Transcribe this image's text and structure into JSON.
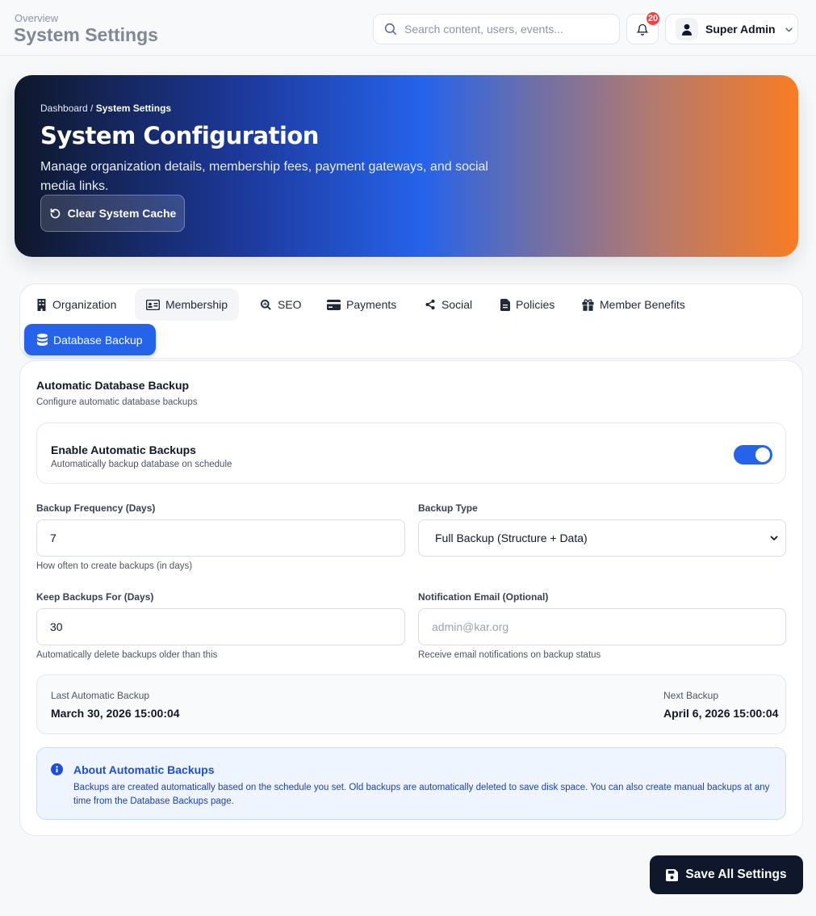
{
  "header": {
    "overview": "Overview",
    "title": "System Settings",
    "search_placeholder": "Search content, users, events...",
    "notifications_count": "20",
    "user_name": "Super Admin"
  },
  "hero": {
    "breadcrumb_root": "Dashboard",
    "breadcrumb_sep": " / ",
    "breadcrumb_current": "System Settings",
    "title": "System Configuration",
    "subtitle": "Manage organization details, membership fees, payment gateways, and social media links.",
    "clear_cache_label": "Clear System Cache"
  },
  "tabs": [
    {
      "label": "Organization",
      "icon": "building-icon"
    },
    {
      "label": "Membership",
      "icon": "id-card-icon"
    },
    {
      "label": "SEO",
      "icon": "search-chart-icon"
    },
    {
      "label": "Payments",
      "icon": "credit-card-icon"
    },
    {
      "label": "Social",
      "icon": "share-icon"
    },
    {
      "label": "Policies",
      "icon": "document-icon"
    },
    {
      "label": "Member Benefits",
      "icon": "gift-icon"
    },
    {
      "label": "Database Backup",
      "icon": "database-icon",
      "active": true
    }
  ],
  "backup": {
    "title": "Automatic Database Backup",
    "subtitle": "Configure automatic database backups",
    "enable_title": "Enable Automatic Backups",
    "enable_sub": "Automatically backup database on schedule",
    "enabled": true,
    "frequency_label": "Backup Frequency (Days)",
    "frequency_value": "7",
    "frequency_help": "How often to create backups (in days)",
    "type_label": "Backup Type",
    "type_value": "Full Backup (Structure + Data)",
    "keep_label": "Keep Backups For (Days)",
    "keep_value": "30",
    "keep_help": "Automatically delete backups older than this",
    "email_label": "Notification Email (Optional)",
    "email_placeholder": "admin@kar.org",
    "email_help": "Receive email notifications on backup status",
    "last_label": "Last Automatic Backup",
    "last_value": "March 30, 2026 15:00:04",
    "next_label": "Next Backup",
    "next_value": "April 6, 2026 15:00:04",
    "info_title": "About Automatic Backups",
    "info_text": "Backups are created automatically based on the schedule you set. Old backups are automatically deleted to save disk space. You can also create manual backups at any time from the Database Backups page."
  },
  "save_label": "Save All Settings",
  "colors": {
    "accent": "#2563eb",
    "dark": "#0f172a",
    "badge": "#ef4444"
  }
}
